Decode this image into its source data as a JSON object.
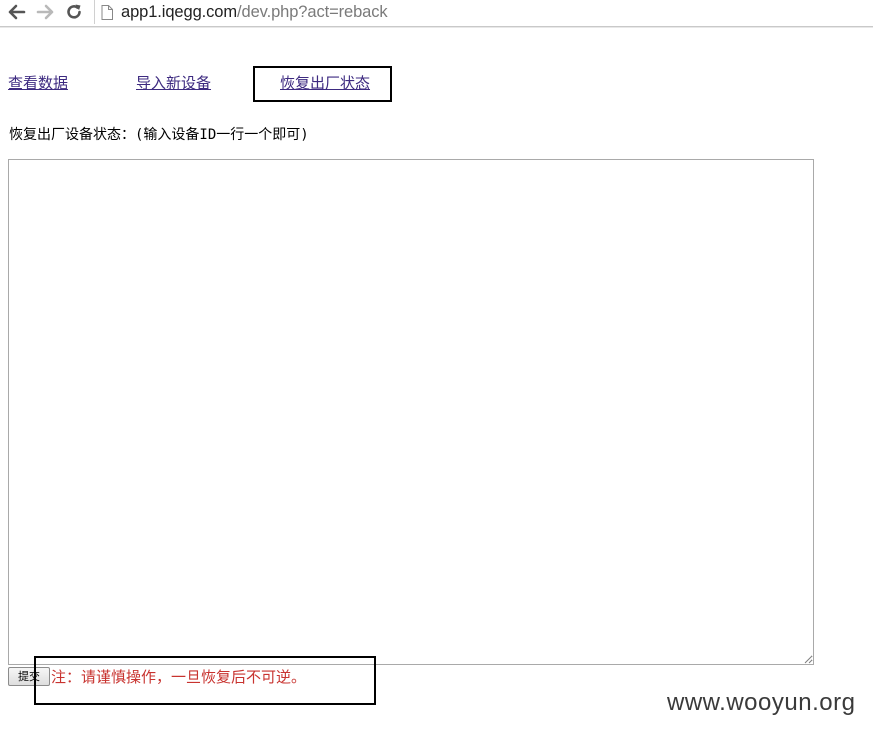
{
  "browser": {
    "url_host": "app1.iqegg.com",
    "url_path": "/dev.php?act=reback",
    "icons": {
      "back": "arrow-left-icon",
      "forward": "arrow-right-icon",
      "reload": "reload-icon",
      "page": "page-icon"
    }
  },
  "nav": {
    "links": [
      {
        "label": "查看数据"
      },
      {
        "label": "导入新设备"
      },
      {
        "label": "恢复出厂状态"
      }
    ],
    "active_index": 2
  },
  "form": {
    "label": "恢复出厂设备状态：(输入设备ID一行一个即可)",
    "textarea_value": "",
    "submit_label": "提交",
    "warning": "注：请谨慎操作，一旦恢复后不可逆。"
  },
  "watermark": "www.wooyun.org",
  "colors": {
    "link": "#3d2a80",
    "warning": "#c8332f",
    "highlight_border": "#000000"
  }
}
